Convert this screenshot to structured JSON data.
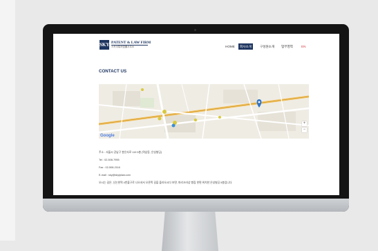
{
  "site": {
    "logo_mark": "SKY",
    "logo_name": "PATENT & LAW FIRM",
    "logo_sub": "스카이특허법률사무소"
  },
  "nav": [
    {
      "label": "HOME",
      "active": false
    },
    {
      "label": "회사소개",
      "active": true
    },
    {
      "label": "구성원소개",
      "active": false
    },
    {
      "label": "업무영역",
      "active": false
    },
    {
      "label": "EN",
      "active": false
    }
  ],
  "page_title": "CONTACT US",
  "map": {
    "attribution": "Google",
    "zoom_in": "+",
    "zoom_out": "−"
  },
  "contact": {
    "address": "주소 : 서울시 강남구 봉은사로 119 5층 (역삼동, 은성빌딩)",
    "tel": "Tel : 02-508-7955",
    "fax": "Fax : 02-508-2116",
    "email": "E-mail : sky@skyiplaw.com",
    "directions": "오시는 길은, 신논현역 4번출구로 나오셔서 오른쪽 길을 올라오시다 보면, 파리크라상 빵집 한편 위치한 은성빌딩 5층입니다."
  },
  "colors": {
    "brand": "#1e3560",
    "lang_accent": "#d23b3b"
  }
}
